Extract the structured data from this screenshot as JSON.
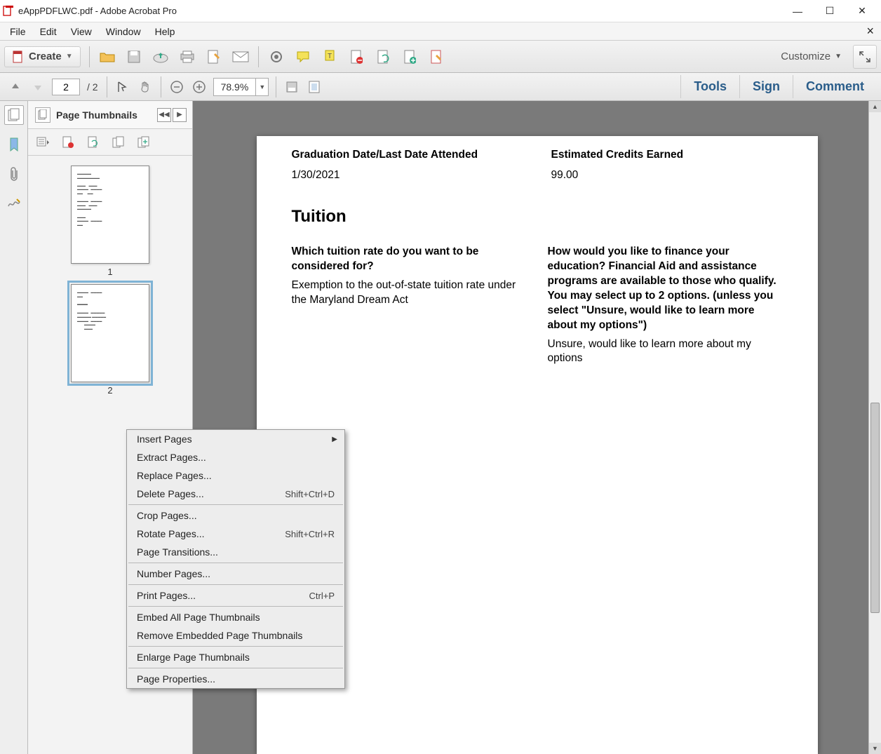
{
  "window": {
    "title": "eAppPDFLWC.pdf - Adobe Acrobat Pro"
  },
  "menubar": [
    "File",
    "Edit",
    "View",
    "Window",
    "Help"
  ],
  "toolbar": {
    "create_label": "Create",
    "customize_label": "Customize"
  },
  "nav": {
    "page_input": "2",
    "page_total": "/  2",
    "zoom": "78.9%"
  },
  "right_tabs": [
    "Tools",
    "Sign",
    "Comment"
  ],
  "thumb_panel": {
    "title": "Page Thumbnails",
    "pages": [
      "1",
      "2"
    ],
    "selected": 1
  },
  "document": {
    "grad_label": "Graduation Date/Last Date Attended",
    "grad_value": "1/30/2021",
    "credits_label": "Estimated Credits Earned",
    "credits_value": "99.00",
    "section_heading": "Tuition",
    "q1": "Which tuition rate do you want to be considered for?",
    "a1": "Exemption to the out-of-state tuition rate under the Maryland Dream Act",
    "q2": "How would you like to finance your education? Financial Aid and assistance programs are available to those who qualify. You may select up to 2 options. (unless you select \"Unsure, would like to learn more about my options\")",
    "a2": "Unsure, would like to learn more about my options"
  },
  "context_menu": {
    "items": [
      {
        "label": "Insert Pages",
        "shortcut": "",
        "submenu": true
      },
      {
        "label": "Extract Pages...",
        "shortcut": ""
      },
      {
        "label": "Replace Pages...",
        "shortcut": ""
      },
      {
        "label": "Delete Pages...",
        "shortcut": "Shift+Ctrl+D"
      },
      {
        "sep": true
      },
      {
        "label": "Crop Pages...",
        "shortcut": ""
      },
      {
        "label": "Rotate Pages...",
        "shortcut": "Shift+Ctrl+R"
      },
      {
        "label": "Page Transitions...",
        "shortcut": ""
      },
      {
        "sep": true
      },
      {
        "label": "Number Pages...",
        "shortcut": ""
      },
      {
        "sep": true
      },
      {
        "label": "Print Pages...",
        "shortcut": "Ctrl+P"
      },
      {
        "sep": true
      },
      {
        "label": "Embed All Page Thumbnails",
        "shortcut": ""
      },
      {
        "label": "Remove Embedded Page Thumbnails",
        "shortcut": ""
      },
      {
        "sep": true
      },
      {
        "label": "Enlarge Page Thumbnails",
        "shortcut": ""
      },
      {
        "sep": true
      },
      {
        "label": "Page Properties...",
        "shortcut": ""
      }
    ]
  }
}
